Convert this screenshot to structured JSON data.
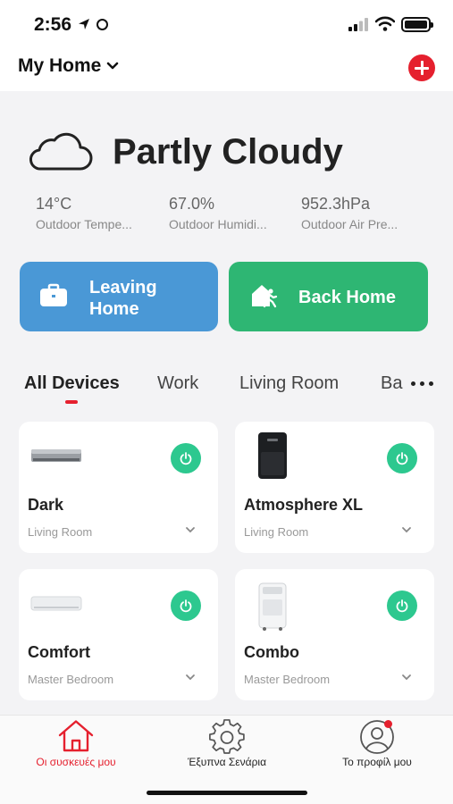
{
  "status_bar": {
    "time": "2:56"
  },
  "header": {
    "home_name": "My Home"
  },
  "weather": {
    "condition": "Partly Cloudy",
    "metrics": [
      {
        "value": "14°C",
        "label": "Outdoor Tempe..."
      },
      {
        "value": "67.0%",
        "label": "Outdoor Humidi..."
      },
      {
        "value": "952.3hPa",
        "label": "Outdoor Air Pre..."
      }
    ]
  },
  "scenes": {
    "leaving": "Leaving Home",
    "back": "Back Home"
  },
  "tabs": [
    {
      "label": "All Devices"
    },
    {
      "label": "Work"
    },
    {
      "label": "Living Room"
    },
    {
      "label": "Ba"
    }
  ],
  "devices": [
    {
      "name": "Dark",
      "room": "Living Room"
    },
    {
      "name": "Atmosphere XL",
      "room": "Living Room"
    },
    {
      "name": "Comfort",
      "room": "Master Bedroom"
    },
    {
      "name": "Combo",
      "room": "Master Bedroom"
    }
  ],
  "bottom_nav": [
    {
      "label": "Οι συσκευές μου"
    },
    {
      "label": "Έξυπνα Σενάρια"
    },
    {
      "label": "Το προφίλ μου"
    }
  ],
  "colors": {
    "accent": "#e5202e",
    "scene_blue": "#4a98d6",
    "scene_green": "#2eb673",
    "power_green": "#2dc88f"
  }
}
